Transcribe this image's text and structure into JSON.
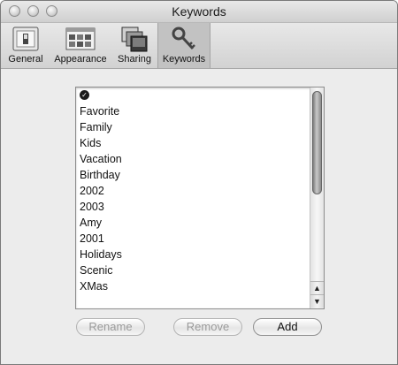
{
  "window": {
    "title": "Keywords"
  },
  "toolbar": {
    "items": [
      {
        "label": "General",
        "icon": "switch-icon"
      },
      {
        "label": "Appearance",
        "icon": "appearance-icon"
      },
      {
        "label": "Sharing",
        "icon": "sharing-icon"
      },
      {
        "label": "Keywords",
        "icon": "key-icon",
        "selected": true
      }
    ]
  },
  "keywords": {
    "first_item_icon": "checkmark-icon",
    "items": [
      "Favorite",
      "Family",
      "Kids",
      "Vacation",
      "Birthday",
      "2002",
      "2003",
      "Amy",
      "2001",
      "Holidays",
      "Scenic",
      "XMas"
    ]
  },
  "buttons": {
    "rename": "Rename",
    "remove": "Remove",
    "add": "Add"
  }
}
